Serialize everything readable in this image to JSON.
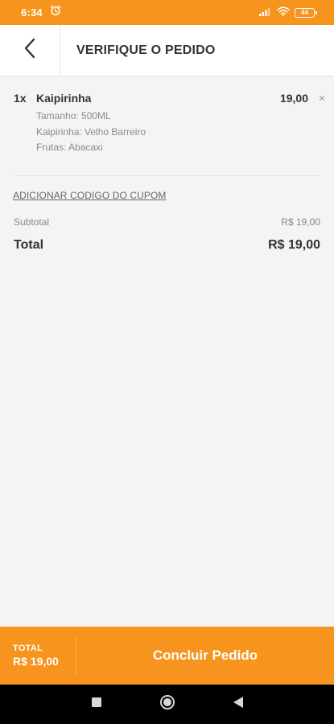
{
  "status_bar": {
    "time": "6:34",
    "battery": "44",
    "icons": [
      "alarm-icon",
      "signal-icon",
      "wifi-icon",
      "battery-icon"
    ]
  },
  "header": {
    "title": "VERIFIQUE O PEDIDO",
    "back_icon": "chevron-left-icon"
  },
  "cart": {
    "items": [
      {
        "qty": "1x",
        "name": "Kaipirinha",
        "price": "19,00",
        "details": [
          "Tamanho: 500ML",
          "Kaipirinha: Velho Barreiro",
          "Frutas: Abacaxi"
        ],
        "remove_label": "×"
      }
    ],
    "coupon_link": "ADICIONAR CODIGO DO CUPOM",
    "subtotal_label": "Subtotal",
    "subtotal_value": "R$ 19,00",
    "total_label": "Total",
    "total_value": "R$ 19,00"
  },
  "footer": {
    "total_label": "TOTAL",
    "total_value": "R$ 19,00",
    "confirm_label": "Concluir Pedido"
  },
  "nav": {
    "icons": [
      "recents-icon",
      "home-icon",
      "back-icon"
    ]
  },
  "colors": {
    "accent": "#f7941d",
    "header_bg": "#ffffff",
    "content_bg": "#f4f4f4",
    "nav_bg": "#000000"
  }
}
